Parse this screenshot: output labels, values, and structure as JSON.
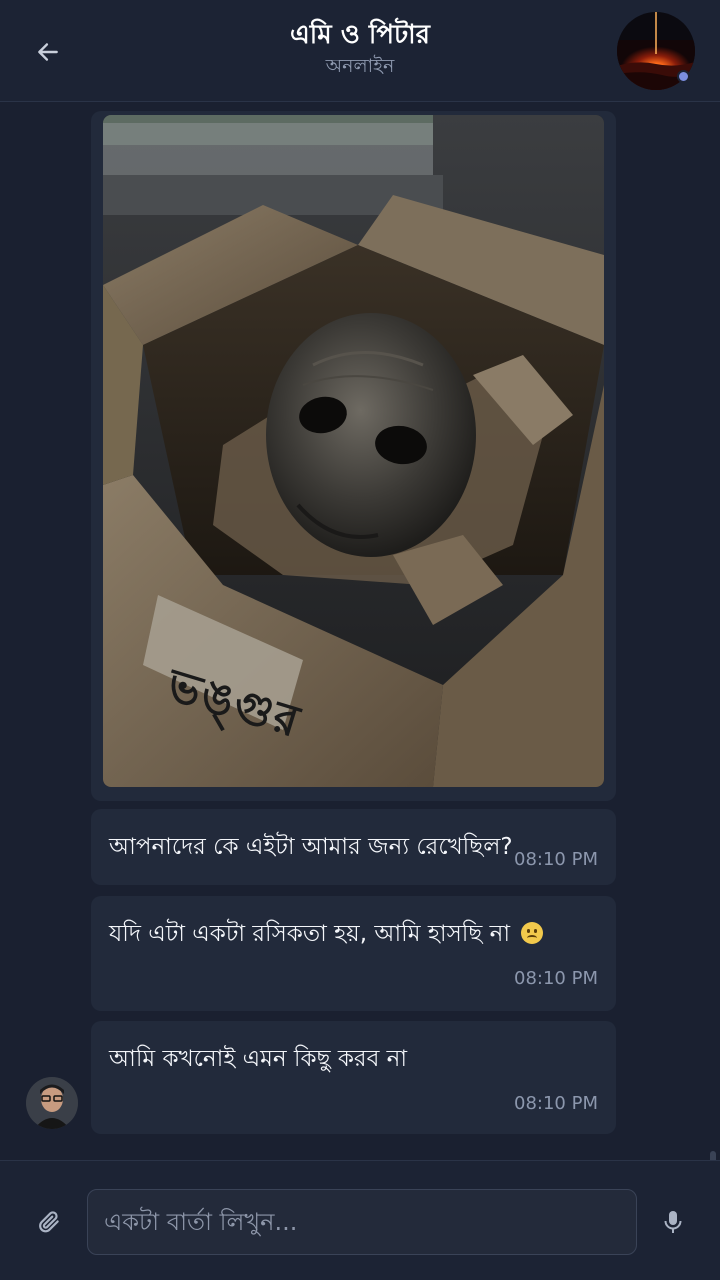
{
  "header": {
    "title": "এমি ও পিটার",
    "status": "অনলাইন",
    "back_icon": "arrow-left-icon",
    "status_dot_color": "#7c8ee0"
  },
  "messages": [
    {
      "type": "image",
      "image_label": "ভঙ্গুর"
    },
    {
      "type": "text",
      "text": "আপনাদের কে এইটা আমার জন্য রেখেছিল?",
      "time": "08:10 PM"
    },
    {
      "type": "text",
      "text": "যদি এটা একটা রসিকতা হয়, আমি হাসছি না",
      "emoji": "frowning-face",
      "time": "08:10 PM"
    },
    {
      "type": "text",
      "text": "আমি কখনোই এমন কিছু করব না",
      "time": "08:10 PM"
    }
  ],
  "composer": {
    "placeholder": "একটা বার্তা লিখুন...",
    "attach_icon": "paperclip-icon",
    "mic_icon": "microphone-icon"
  },
  "colors": {
    "background": "#1a2030",
    "bubble": "#222a3b",
    "header": "#1c2334"
  }
}
